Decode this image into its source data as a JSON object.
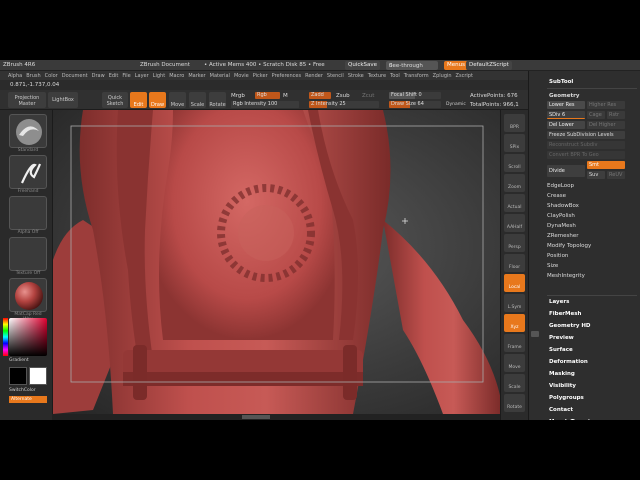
{
  "titlebar": {
    "app": "ZBrush 4R6",
    "document": "ZBrush Document",
    "mem": "• Active Mems 400 • Scratch Disk 85 • Free",
    "quicksave": "QuickSave",
    "seethrough": "See-through",
    "seethrough_val": "0",
    "menus": "Menus",
    "script": "DefaultZScript"
  },
  "menubar": [
    "Alpha",
    "Brush",
    "Color",
    "Document",
    "Draw",
    "Edit",
    "File",
    "Layer",
    "Light",
    "Macro",
    "Marker",
    "Material",
    "Movie",
    "Picker",
    "Preferences",
    "Render",
    "Stencil",
    "Stroke",
    "Texture",
    "Tool",
    "Transform",
    "Zplugin",
    "Zscript"
  ],
  "coords": "0.871,-1.737,0.04",
  "toolbar": {
    "projection_master": "Projection Master",
    "lightbox": "LightBox",
    "quick_sketch": "Quick Sketch",
    "edit": "Edit",
    "draw": "Draw",
    "move": "Move",
    "scale": "Scale",
    "rotate": "Rotate",
    "mrgb": "Mrgb",
    "rgb": "Rgb",
    "m": "M",
    "zadd": "Zadd",
    "zsub": "Zsub",
    "zcut": "Zcut",
    "rgb_intensity": "Rgb Intensity",
    "rgb_intensity_val": "100",
    "z_intensity": "Z Intensity",
    "z_intensity_val": "25",
    "focal_shift": "Focal Shift",
    "focal_shift_val": "0",
    "draw_size": "Draw Size",
    "draw_size_val": "64",
    "dynamic": "Dynamic",
    "active_points": "ActivePoints: 676",
    "total_points": "TotalPoints: 966,1"
  },
  "leftshelf": {
    "brush1": "Standard",
    "brush2": "Freehand",
    "alpha": "Alpha Off",
    "texture": "Texture Off",
    "material": "MatCap Red Wax",
    "gradient": "Gradient",
    "switchcolor": "SwitchColor",
    "alternate": "Alternate"
  },
  "rightshelf": [
    "BPR",
    "SPix",
    "Scroll",
    "Zoom",
    "Actual",
    "AAHalf",
    "Persp",
    "Floor",
    "Local",
    "L.Sym",
    "Xyz",
    "Frame",
    "Move",
    "Scale",
    "Rotate"
  ],
  "tray": {
    "subtool": "SubTool",
    "geometry": "Geometry",
    "lower_res": "Lower Res",
    "higher_res": "Higher Res",
    "sdiv": "SDiv",
    "sdiv_val": "6",
    "cage": "Cage",
    "rstr": "Rstr",
    "del_lower": "Del Lower",
    "del_higher": "Del Higher",
    "freeze": "Freeze SubDivision Levels",
    "reconstruct": "Reconstruct Subdiv",
    "convert_bpr": "Convert BPR To Geo",
    "divide": "Divide",
    "smt": "Smt",
    "suv": "Suv",
    "reuv": "ReUV",
    "items": [
      "EdgeLoop",
      "Crease",
      "ShadowBox",
      "ClayPolish",
      "DynaMesh",
      "ZRemesher",
      "Modify Topology",
      "Position",
      "Size",
      "MeshIntegrity"
    ],
    "sections": [
      "Layers",
      "FiberMesh",
      "Geometry HD",
      "Preview",
      "Surface",
      "Deformation",
      "Masking",
      "Visibility",
      "Polygroups",
      "Contact",
      "Morph Target"
    ]
  },
  "colors": {
    "accent": "#e8781c",
    "model": "#b84a48",
    "bg": "#2a2a2a"
  }
}
